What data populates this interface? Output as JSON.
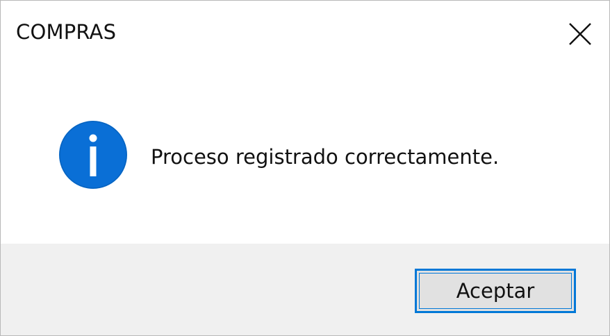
{
  "window": {
    "title": "COMPRAS"
  },
  "titlebar": {
    "close_icon": "close-icon"
  },
  "message": {
    "icon": "info-icon",
    "text": "Proceso registrado correctamente."
  },
  "footer": {
    "ok_label": "Aceptar"
  },
  "colors": {
    "accent": "#0078d7",
    "info_icon": "#0a6fd6",
    "footer_bg": "#f0f0f0",
    "button_bg": "#e1e1e1"
  }
}
